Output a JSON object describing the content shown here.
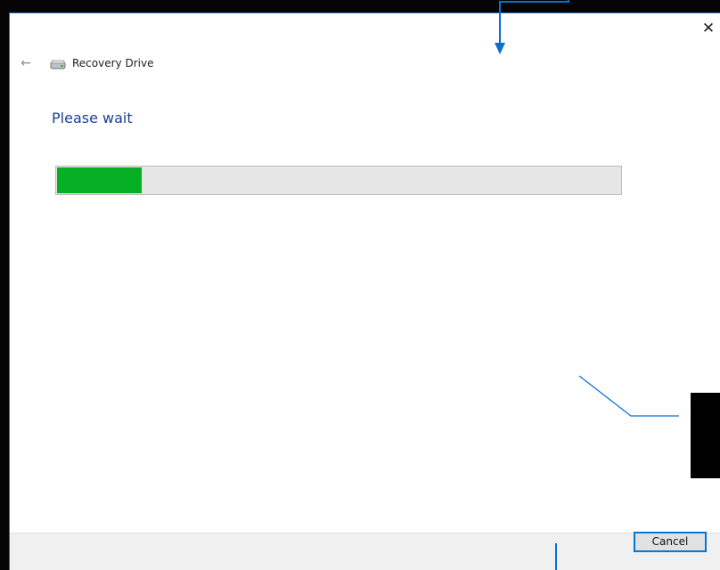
{
  "window": {
    "title": "Recovery Drive",
    "close_symbol": "✕",
    "back_symbol": "←"
  },
  "main": {
    "heading": "Please wait",
    "progress_percent": 15
  },
  "footer": {
    "cancel_label": "Cancel"
  },
  "icons": {
    "back": "back-arrow-icon",
    "drive": "drive-icon",
    "close": "close-icon"
  },
  "colors": {
    "accent_border": "#2a6fc0",
    "heading": "#1c3f94",
    "progress_fill": "#06b025",
    "progress_track": "#e6e6e6",
    "annotation": "#0a6fd0"
  }
}
